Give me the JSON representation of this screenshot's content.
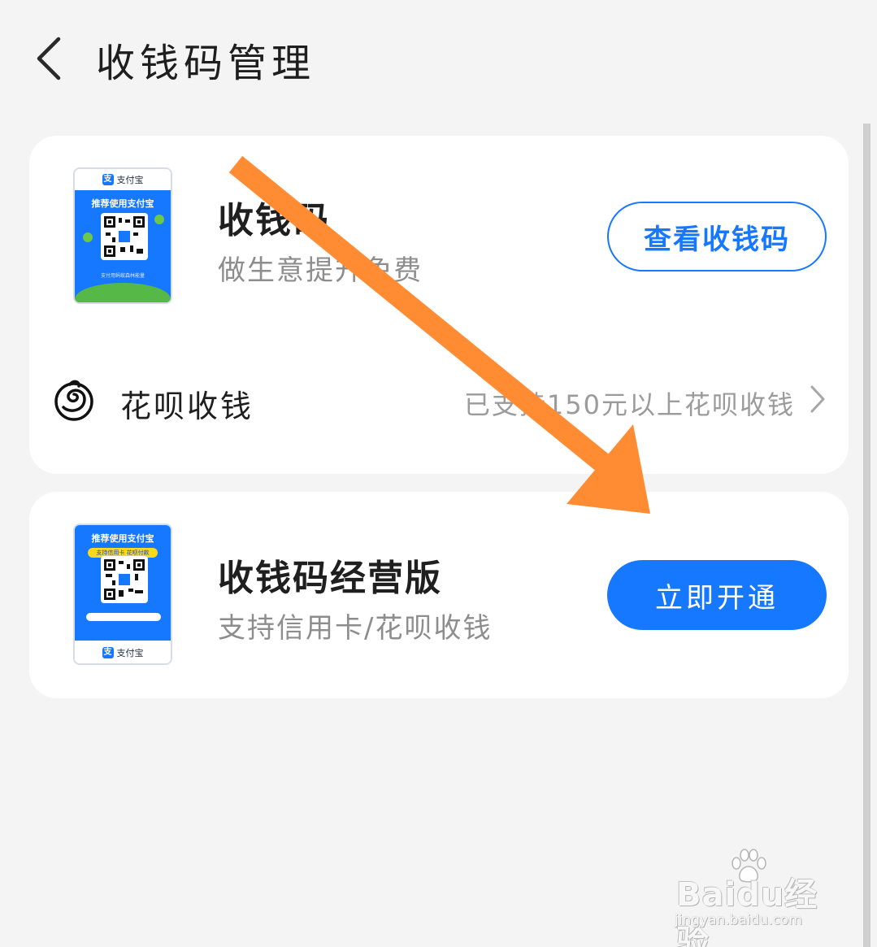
{
  "header": {
    "title": "收钱码管理",
    "back_icon": "chevron-left-icon"
  },
  "cards": [
    {
      "thumbnail": {
        "brand": "支付宝",
        "logo_char": "支",
        "headline": "推荐使用支付宝",
        "caption": "支付用蚂蚁森林能量"
      },
      "title": "收钱码",
      "subtitle": "做生意提升免费",
      "button_label": "查看收钱码",
      "huabei": {
        "icon": "huabei-icon",
        "label": "花呗收钱",
        "status": "已支持150元以上花呗收钱",
        "chevron_icon": "chevron-right-icon"
      }
    },
    {
      "thumbnail": {
        "brand": "支付宝",
        "logo_char": "支",
        "headline": "推荐使用支付宝",
        "tag": "支持信用卡 花呗付款"
      },
      "title": "收钱码经营版",
      "subtitle": "支持信用卡/花呗收钱",
      "button_label": "立即开通"
    }
  ],
  "watermark": {
    "brand": "Baidu经验",
    "url": "jingyan.baidu.com"
  },
  "colors": {
    "accent": "#1677ff",
    "background": "#f4f4f4",
    "annotation_arrow": "#ff8c33"
  }
}
